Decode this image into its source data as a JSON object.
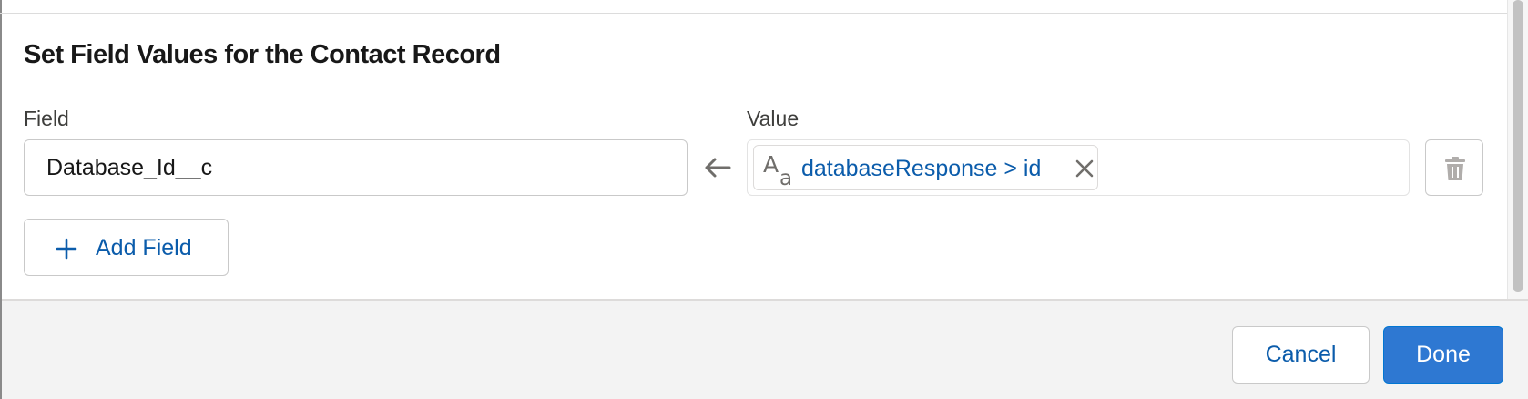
{
  "section": {
    "title": "Set Field Values for the Contact Record"
  },
  "mapping": {
    "field_label": "Field",
    "value_label": "Value",
    "field_value": "Database_Id__c",
    "value_pill_text": "databaseResponse > id",
    "value_pill_icon": "text-type-icon",
    "arrow_icon": "arrow-left-icon",
    "delete_icon": "trash-icon"
  },
  "actions": {
    "add_field_label": "Add Field",
    "cancel_label": "Cancel",
    "done_label": "Done"
  },
  "colors": {
    "link_blue": "#0b5cab",
    "brand_blue": "#2e78d2",
    "border": "#c9c9c9",
    "footer_bg": "#f3f3f3"
  }
}
